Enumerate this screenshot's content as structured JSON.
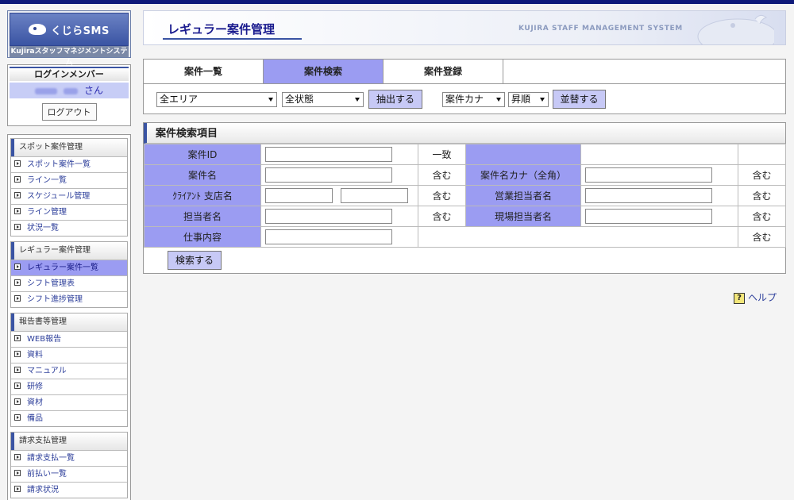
{
  "logo": {
    "title": "くじらSMS",
    "subtitle": "Kujiraスタッフマネジメントシステム"
  },
  "login": {
    "title": "ログインメンバー",
    "user_suffix": "さん",
    "logout_label": "ログアウト"
  },
  "nav": {
    "groups": [
      {
        "title": "スポット案件管理",
        "items": [
          "スポット案件一覧",
          "ライン一覧",
          "スケジュール管理",
          "ライン管理",
          "状況一覧"
        ]
      },
      {
        "title": "レギュラー案件管理",
        "items": [
          "レギュラー案件一覧",
          "シフト管理表",
          "シフト進捗管理"
        ]
      },
      {
        "title": "報告書等管理",
        "items": [
          "WEB報告",
          "資料",
          "マニュアル",
          "研修",
          "資材",
          "備品"
        ]
      },
      {
        "title": "請求支払管理",
        "items": [
          "請求支払一覧",
          "前払い一覧",
          "請求状況"
        ]
      }
    ]
  },
  "header": {
    "title": "レギュラー案件管理",
    "system_name": "KUJIRA STAFF MANAGEMENT SYSTEM"
  },
  "tabs": [
    "案件一覧",
    "案件検索",
    "案件登録"
  ],
  "filters": {
    "area": "全エリア",
    "status": "全状態",
    "extract_label": "抽出する",
    "sort_key": "案件カナ",
    "sort_order": "昇順",
    "sort_label": "並替する"
  },
  "search": {
    "title": "案件検索項目",
    "labels": {
      "case_id": "案件ID",
      "case_name": "案件名",
      "case_kana": "案件名カナ（全角）",
      "client_branch": "ｸﾗｲｱﾝﾄ 支店名",
      "sales_rep": "営業担当者名",
      "rep": "担当者名",
      "site_rep": "現場担当者名",
      "job": "仕事内容"
    },
    "match": {
      "exact": "一致",
      "contains": "含む"
    },
    "submit_label": "検索する"
  },
  "help": {
    "label": "ヘルプ",
    "icon": "?"
  }
}
